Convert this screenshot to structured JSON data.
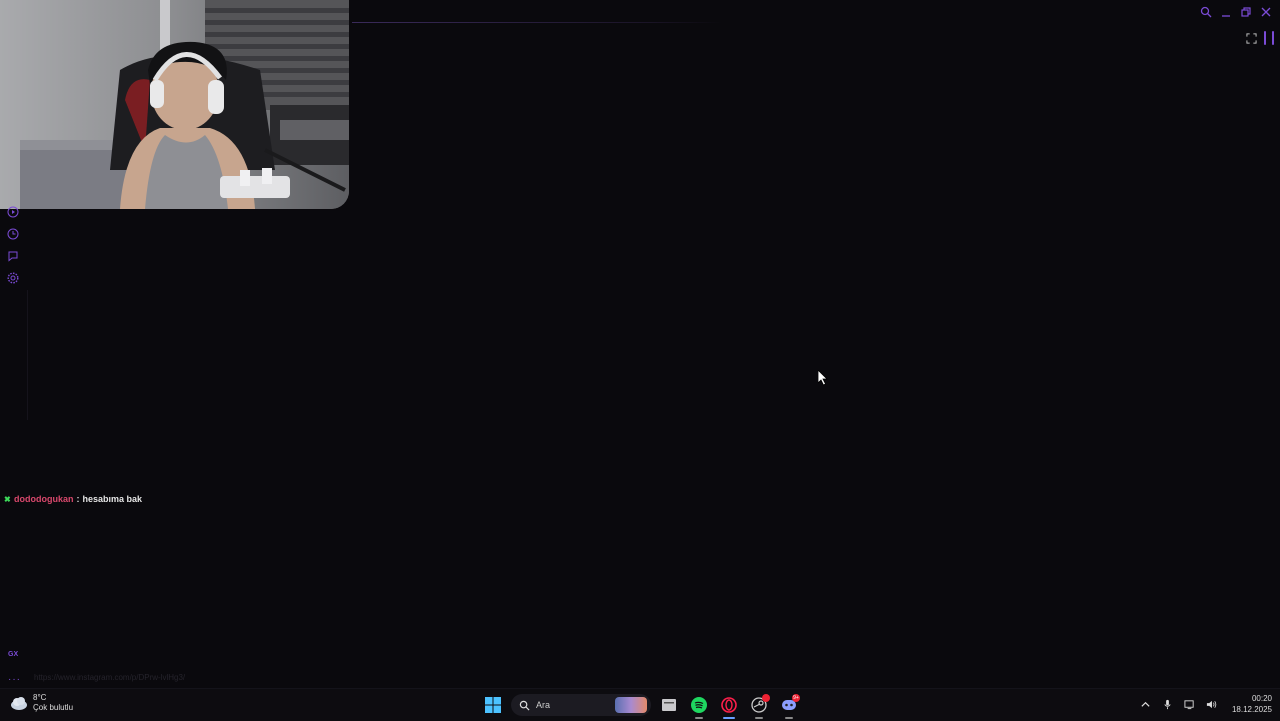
{
  "webcam": {
    "description_icon": "webcam-feed"
  },
  "sidebar": {
    "icons": [
      "play-icon",
      "history-icon",
      "chat-icon",
      "settings-icon"
    ]
  },
  "chat": {
    "messages": [
      {
        "username": "dododogukan",
        "separator": ":",
        "text": "hesabıma bak",
        "badge_color": "#3dd95a",
        "username_color": "#d9486c"
      }
    ]
  },
  "bottom": {
    "gx_label": "GX",
    "url_text": "https://www.instagram.com/p/DPrw-lvlHg3/"
  },
  "taskbar": {
    "weather": {
      "temp": "8°C",
      "condition": "Çok bulutlu"
    },
    "search_placeholder": "Ara",
    "clock": {
      "time": "00:20",
      "date": "18.12.2025"
    },
    "discord_badge": "9+"
  },
  "colors": {
    "accent": "#7b4bd6",
    "background": "#0a090d"
  }
}
